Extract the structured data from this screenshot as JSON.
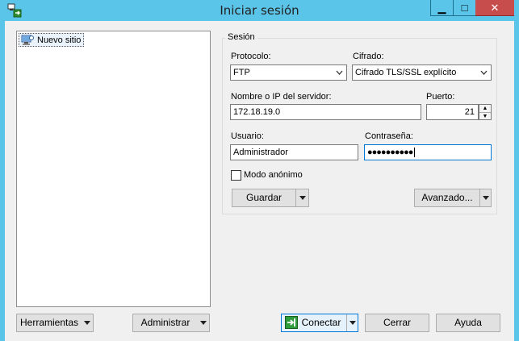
{
  "window": {
    "title": "Iniciar sesión",
    "minimize_glyph": "▁",
    "maximize_glyph": "□",
    "close_glyph": "✕",
    "icon": "app-sites-icon"
  },
  "tree": {
    "items": [
      {
        "label": "Nuevo sitio",
        "icon": "server-site-icon"
      }
    ]
  },
  "session": {
    "legend": "Sesión",
    "protocol": {
      "label": "Protocolo:",
      "value": "FTP"
    },
    "encryption": {
      "label": "Cifrado:",
      "value": "Cifrado TLS/SSL explícito"
    },
    "host": {
      "label": "Nombre o IP del servidor:",
      "value": "172.18.19.0"
    },
    "port": {
      "label": "Puerto:",
      "value": "21"
    },
    "user": {
      "label": "Usuario:",
      "value": "Administrador"
    },
    "password": {
      "label": "Contraseña:",
      "value": "●●●●●●●●●●"
    },
    "anonymous": {
      "label": "Modo anónimo",
      "checked": false
    },
    "save_label": "Guardar",
    "advanced_label": "Avanzado..."
  },
  "footer": {
    "tools_label": "Herramientas",
    "manage_label": "Administrar",
    "connect_label": "Conectar",
    "cancel_label": "Cerrar",
    "help_label": "Ayuda"
  },
  "colors": {
    "titlebar": "#5bc5e9",
    "close": "#c74d4d",
    "client": "#f0f0f0",
    "focus_border": "#0078d7"
  }
}
